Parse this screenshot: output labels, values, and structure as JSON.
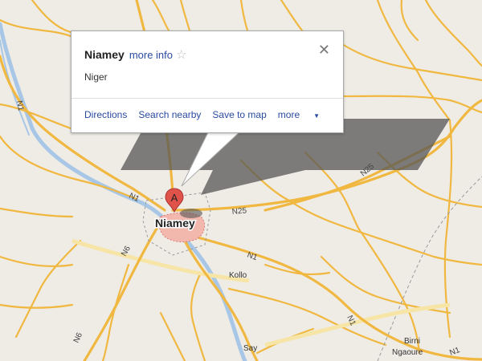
{
  "infowindow": {
    "place_name": "Niamey",
    "more_info": "more info",
    "star_icon": "star-outline-icon",
    "close_icon": "close-icon",
    "country": "Niger",
    "actions": {
      "directions": "Directions",
      "search_nearby": "Search nearby",
      "save_to_map": "Save to map",
      "more": "more"
    }
  },
  "marker": {
    "letter": "A",
    "color": "#e0534a"
  },
  "map_labels": {
    "city": "Niamey",
    "kollo": "Kollo",
    "say": "Say",
    "birni": "Birni",
    "ngaoure": "Ngaoure"
  },
  "road_labels": {
    "n1_west": "N1",
    "n1_top_left": "N1",
    "n1_center": "N1",
    "n1_south": "N1",
    "n1_east": "N1",
    "n25_center": "N25",
    "n25_east": "N25",
    "n6_a": "N6",
    "n6_b": "N6"
  },
  "colors": {
    "road": "#f0b840",
    "river": "#a8c6e6",
    "background": "#efece6",
    "link": "#2b4ba1"
  }
}
